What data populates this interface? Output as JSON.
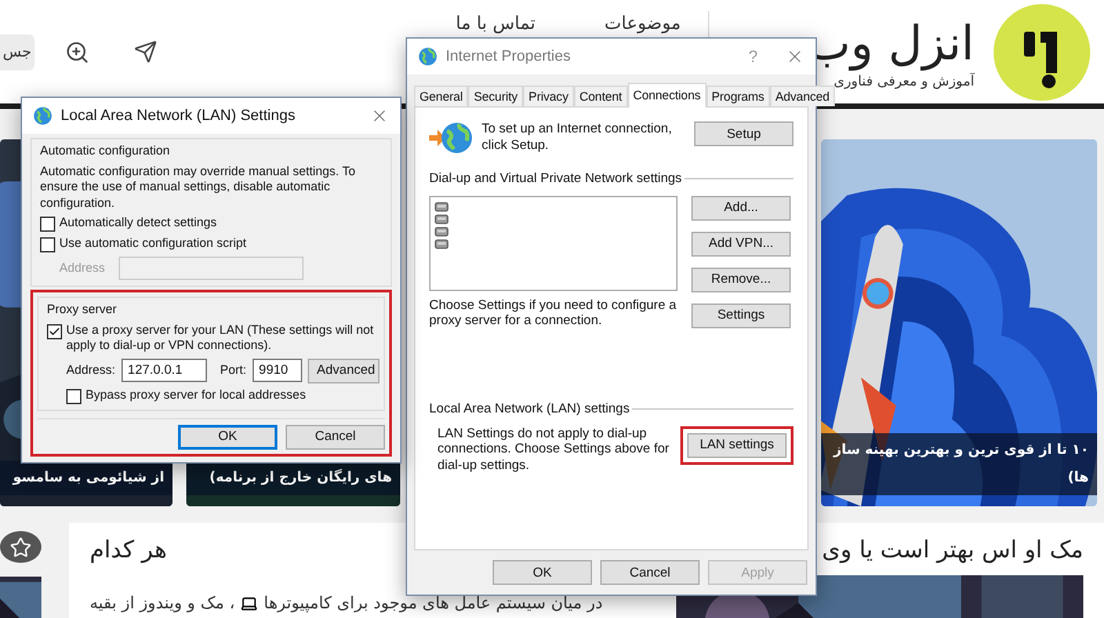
{
  "website": {
    "header": {
      "search_button": "جس",
      "nav": [
        {
          "label": "موضوعات"
        },
        {
          "label": "تماس با ما"
        }
      ],
      "brand": {
        "name": "انزل وب",
        "tagline": "آموزش و معرفی فناوری"
      }
    },
    "featured": [
      {
        "caption": [
          "۱۰ تا از قوی ترین و بهترین بهینه ساز",
          "ها)"
        ]
      },
      {
        "caption": [
          "های رایگان خارج از برنامه)"
        ]
      },
      {
        "caption": [
          "از شیائومی به سامسو"
        ]
      }
    ],
    "article": {
      "title_parts": [
        "مک او اس بهتر است یا وی",
        "هر کدام"
      ],
      "excerpt": [
        "در میان سیستم عامل های موجود برای کامپیوترها",
        "، مک و ویندوز از بقیه"
      ]
    }
  },
  "internet_properties": {
    "title": "Internet Properties",
    "help": "?",
    "tabs": [
      {
        "label": "General",
        "selected": false
      },
      {
        "label": "Security",
        "selected": false
      },
      {
        "label": "Privacy",
        "selected": false
      },
      {
        "label": "Content",
        "selected": false
      },
      {
        "label": "Connections",
        "selected": true
      },
      {
        "label": "Programs",
        "selected": false
      },
      {
        "label": "Advanced",
        "selected": false
      }
    ],
    "setup": {
      "text": "To set up an Internet connection, click Setup.",
      "button": "Setup"
    },
    "dialup": {
      "heading": "Dial-up and Virtual Private Network settings",
      "connections": [
        {
          "kind": "network"
        },
        {
          "kind": "network"
        },
        {
          "kind": "network"
        },
        {
          "kind": "network"
        }
      ],
      "buttons": [
        {
          "label": "Add..."
        },
        {
          "label": "Add VPN..."
        },
        {
          "label": "Remove..."
        },
        {
          "label": "Settings"
        }
      ]
    },
    "proxy_note": "Choose Settings if you need to configure a proxy server for a connection.",
    "lan": {
      "heading": "Local Area Network (LAN) settings",
      "text": "LAN Settings do not apply to dial-up connections. Choose Settings above for dial-up settings.",
      "button": {
        "label": "LAN settings",
        "highlighted": true
      }
    },
    "footer": [
      {
        "label": "OK",
        "disabled": false
      },
      {
        "label": "Cancel",
        "disabled": false
      },
      {
        "label": "Apply",
        "disabled": true
      }
    ]
  },
  "lan_settings": {
    "title": "Local Area Network (LAN) Settings",
    "automatic": {
      "heading": "Automatic configuration",
      "text": "Automatic configuration may override manual settings.  To ensure the use of manual settings, disable automatic configuration.",
      "options": [
        {
          "label": "Automatically detect settings",
          "checked": false
        },
        {
          "label": "Use automatic configuration script",
          "checked": false
        }
      ],
      "address": {
        "label": "Address",
        "disabled": true
      }
    },
    "proxy": {
      "highlighted": true,
      "heading": "Proxy server",
      "use_proxy": {
        "label": "Use a proxy server for your LAN (These settings will not apply to dial-up or VPN connections).",
        "checked": true
      },
      "address": {
        "label": "Address:",
        "value": "127.0.0.1"
      },
      "port": {
        "label": "Port:",
        "value": "9910"
      },
      "advanced": "Advanced",
      "bypass": {
        "label": "Bypass proxy server for local addresses",
        "checked": false
      }
    },
    "buttons": [
      {
        "label": "OK",
        "default": true
      },
      {
        "label": "Cancel",
        "default": false
      }
    ]
  }
}
